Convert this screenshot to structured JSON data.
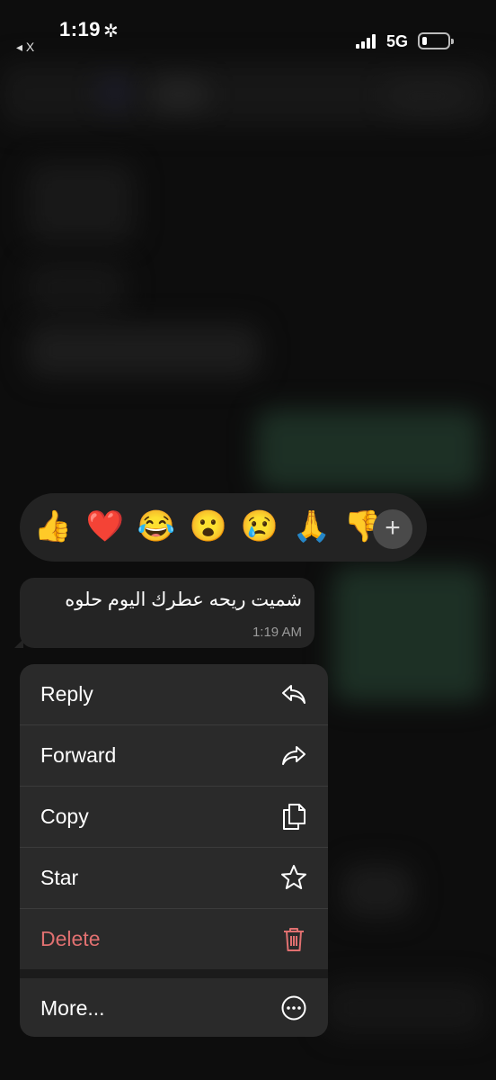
{
  "status_bar": {
    "time": "1:19",
    "back_label": "◂ X",
    "network": "5G"
  },
  "reactions": {
    "emojis": [
      "👍",
      "❤️",
      "😂",
      "😮",
      "😢",
      "🙏",
      "👎"
    ],
    "more_icon": "plus-icon"
  },
  "message": {
    "text": "شميت ريحه عطرك اليوم حلوه",
    "time": "1:19 AM"
  },
  "menu": {
    "items": [
      {
        "label": "Reply",
        "icon": "reply-icon"
      },
      {
        "label": "Forward",
        "icon": "forward-icon"
      },
      {
        "label": "Copy",
        "icon": "copy-icon"
      },
      {
        "label": "Star",
        "icon": "star-icon"
      },
      {
        "label": "Delete",
        "icon": "trash-icon"
      },
      {
        "label": "More...",
        "icon": "more-icon"
      }
    ],
    "delete_color": "#e07070"
  }
}
